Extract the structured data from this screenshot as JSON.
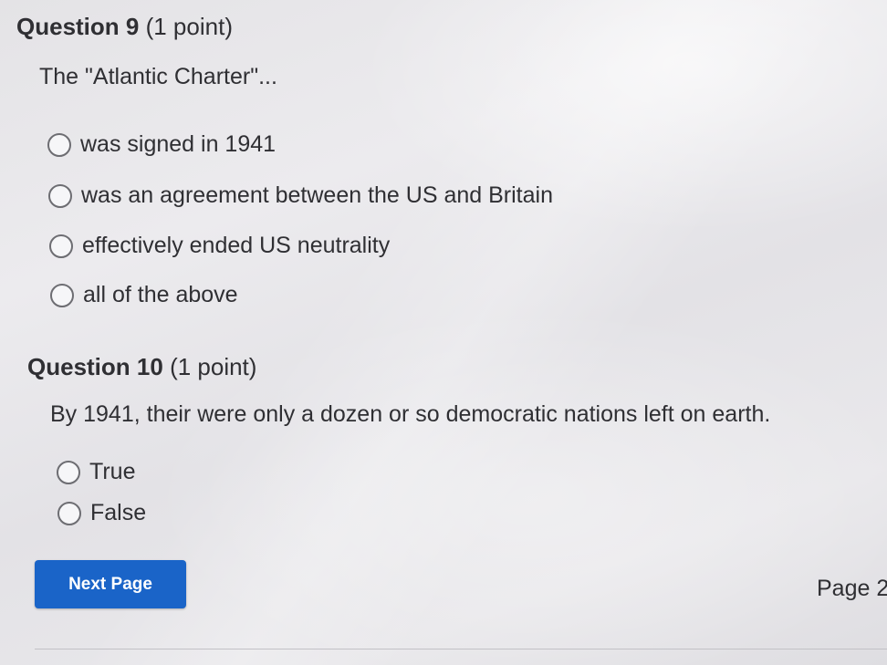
{
  "questions": [
    {
      "number": "Question 9",
      "points": "(1 point)",
      "text": "The \"Atlantic Charter\"...",
      "options": [
        "was signed in 1941",
        "was an agreement between the US and Britain",
        "effectively ended US neutrality",
        "all of the above"
      ]
    },
    {
      "number": "Question 10",
      "points": "(1 point)",
      "text": "By 1941, their were only a dozen or so democratic nations left on earth.",
      "options": [
        "True",
        "False"
      ]
    }
  ],
  "footer": {
    "next_label": "Next Page",
    "page_label": "Page 2"
  },
  "colors": {
    "button": "#1a64c8",
    "text": "#2f2f33",
    "radio_border": "#6d6d72"
  }
}
